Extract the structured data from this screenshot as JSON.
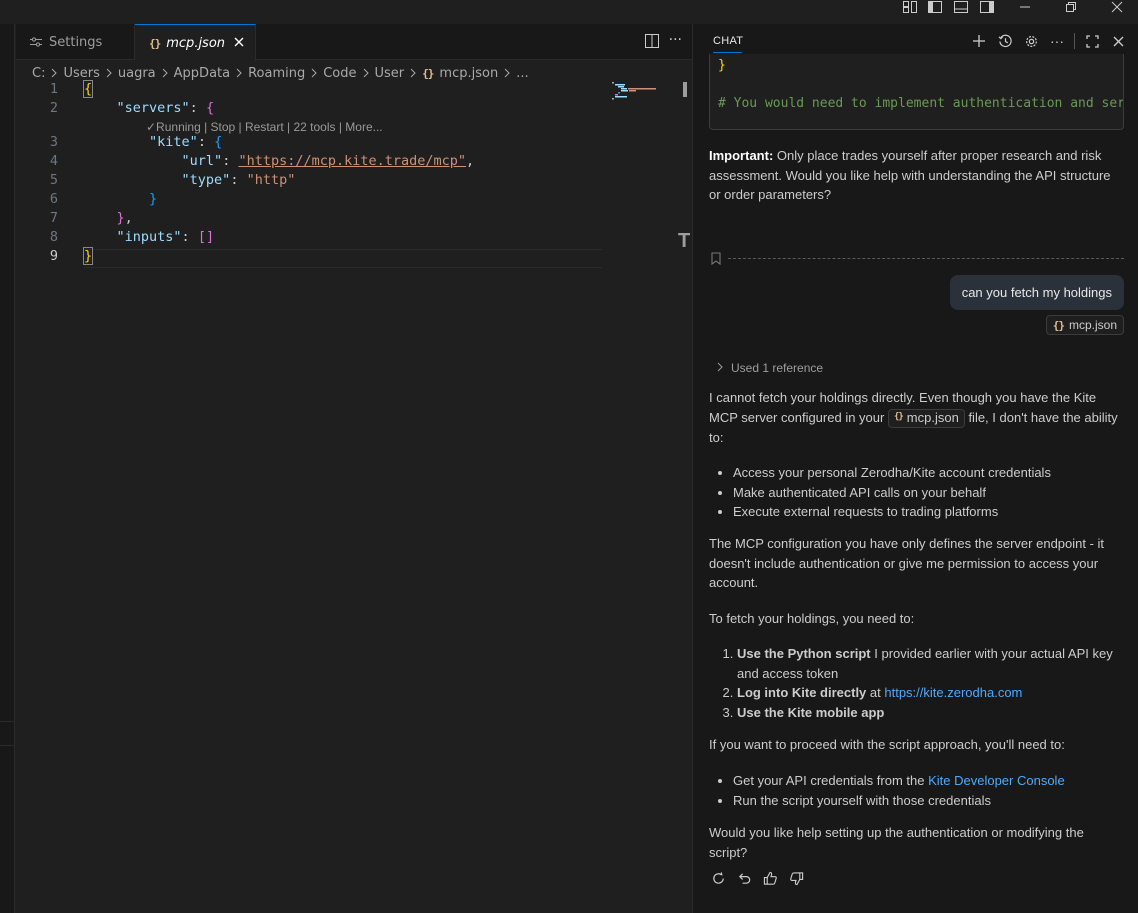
{
  "editor": {
    "tabs": [
      {
        "label": "Settings"
      },
      {
        "label": "mcp.json"
      }
    ],
    "breadcrumb": [
      "C:",
      "Users",
      "uagra",
      "AppData",
      "Roaming",
      "Code",
      "User",
      "mcp.json",
      "..."
    ],
    "line_numbers": [
      "1",
      "2",
      "3",
      "4",
      "5",
      "6",
      "7",
      "8",
      "9"
    ],
    "codelens": "✓Running | Stop | Restart | 22 tools | More...",
    "code": {
      "servers_key": "\"servers\"",
      "kite_key": "\"kite\"",
      "url_key": "\"url\"",
      "url_value": "\"https://mcp.kite.trade/mcp\"",
      "type_key": "\"type\"",
      "type_value": "\"http\"",
      "inputs_key": "\"inputs\""
    },
    "sash_label": "T"
  },
  "chat": {
    "title": "CHAT",
    "prev_code_brace": "}",
    "prev_code_comment": "# You would need to implement authentication and ser",
    "important_label": "Important:",
    "important_text": " Only place trades yourself after proper research and risk assessment. Would you like help with understanding the API structure or order parameters?",
    "user_message": "can you fetch my holdings",
    "user_reference": "mcp.json",
    "used_reference": "Used 1 reference",
    "answer": {
      "p1_a": "I cannot fetch your holdings directly. Even though you have the Kite MCP server configured in your ",
      "p1_chip": "mcp.json",
      "p1_b": " file, I don't have the ability to:",
      "bullets1": [
        "Access your personal Zerodha/Kite account credentials",
        "Make authenticated API calls on your behalf",
        "Execute external requests to trading platforms"
      ],
      "p2": "The MCP configuration you have only defines the server endpoint - it doesn't include authentication or give me permission to access your account.",
      "p3": "To fetch your holdings, you need to:",
      "steps": [
        {
          "bold": "Use the Python script",
          "text": " I provided earlier with your actual API key and access token"
        },
        {
          "bold": "Log into Kite directly",
          "text": " at ",
          "link": "https://kite.zerodha.com"
        },
        {
          "bold": "Use the Kite mobile app",
          "text": ""
        }
      ],
      "p4": "If you want to proceed with the script approach, you'll need to:",
      "bullets2_item1_text": "Get your API credentials from the ",
      "bullets2_item1_link": "Kite Developer Console",
      "bullets2_item2": "Run the script yourself with those credentials",
      "p5": "Would you like help setting up the authentication or modifying the script?"
    }
  },
  "colors": {
    "accent": "#0078d4",
    "link": "#4daafc"
  },
  "icons": {
    "titlebar": [
      "layout-customize-icon",
      "toggle-primary-sidebar-icon",
      "toggle-panel-icon",
      "toggle-secondary-sidebar-icon",
      "minimize-icon",
      "restore-icon",
      "close-window-icon"
    ],
    "chat_header": [
      "new-chat-icon",
      "history-icon",
      "settings-gear-icon",
      "more-actions-icon",
      "maximize-icon",
      "close-icon"
    ],
    "feedback": [
      "retry-icon",
      "undo-icon",
      "thumbs-up-icon",
      "thumbs-down-icon"
    ]
  }
}
